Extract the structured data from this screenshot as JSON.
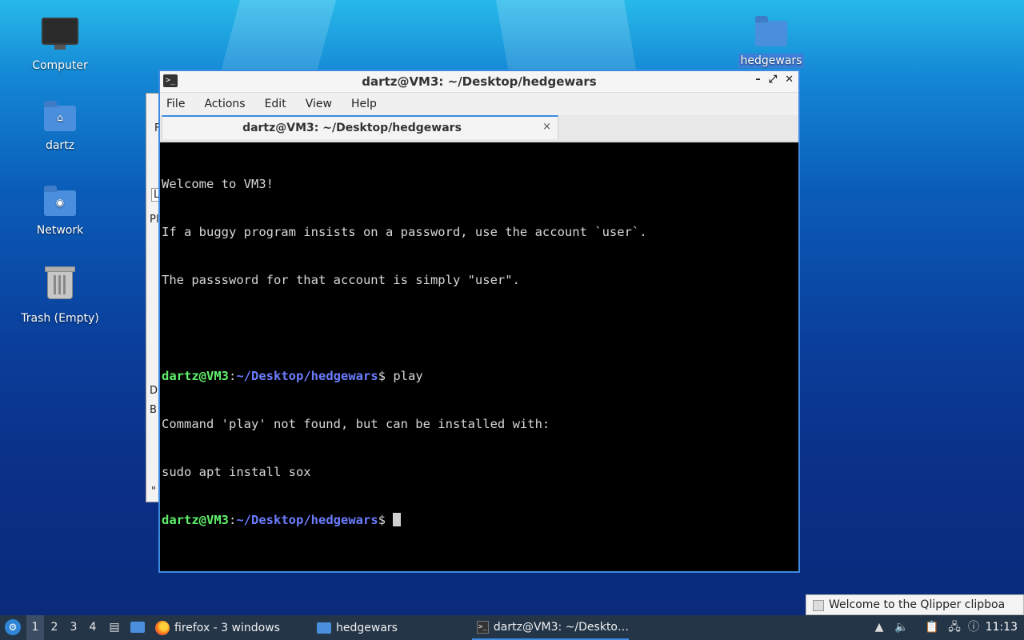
{
  "desktop": {
    "icons": {
      "computer": "Computer",
      "home": "dartz",
      "network": "Network",
      "trash": "Trash (Empty)",
      "hedgewars": "hedgewars"
    }
  },
  "background_window": {
    "fragments": [
      "F",
      "L",
      "Pl",
      "D",
      "B",
      "\""
    ]
  },
  "terminal": {
    "window_title": "dartz@VM3: ~/Desktop/hedgewars",
    "menu": [
      "File",
      "Actions",
      "Edit",
      "View",
      "Help"
    ],
    "tab_title": "dartz@VM3: ~/Desktop/hedgewars",
    "tab_close": "×",
    "lines": [
      "Welcome to VM3!",
      "If a buggy program insists on a password, use the account `user`.",
      "The passsword for that account is simply \"user\".",
      "",
      "Command 'play' not found, but can be installed with:",
      "sudo apt install sox"
    ],
    "prompt_user": "dartz@VM3",
    "prompt_sep": ":",
    "prompt_path": "~/Desktop/hedgewars",
    "prompt_end": "$ ",
    "command_1": "play"
  },
  "notification": {
    "text": "Welcome to the Qlipper clipboa"
  },
  "taskbar": {
    "workspaces": [
      "1",
      "2",
      "3",
      "4"
    ],
    "active_workspace": "1",
    "tasks": {
      "firefox": "firefox - 3 windows",
      "hedgewars": "hedgewars",
      "terminal": "dartz@VM3: ~/Deskto…"
    },
    "clock": "11:13"
  },
  "colors": {
    "accent": "#3c8be0",
    "prompt_user": "#5ef06a",
    "prompt_path": "#6b7cff",
    "taskbar": "#243547"
  }
}
